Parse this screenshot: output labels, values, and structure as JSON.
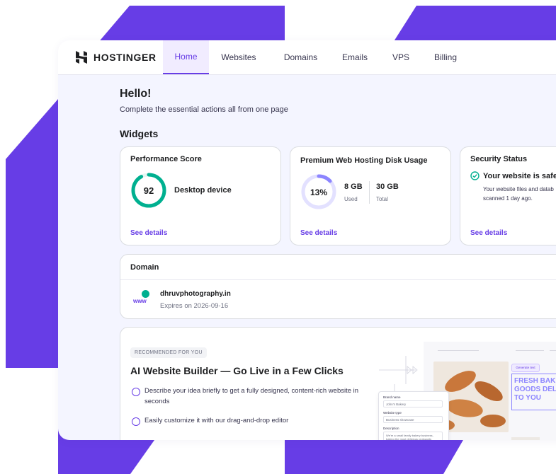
{
  "brand": {
    "name": "HOSTINGER",
    "accent": "#673de6",
    "logo_icon": "hostinger-logo"
  },
  "nav": {
    "items": [
      "Home",
      "Websites",
      "Domains",
      "Emails",
      "VPS",
      "Billing"
    ],
    "active": "Home"
  },
  "greeting": {
    "title": "Hello!",
    "subtitle": "Complete the essential actions all from one page"
  },
  "widgets": {
    "heading": "Widgets",
    "performance": {
      "title": "Performance Score",
      "score": "92",
      "score_value": 92,
      "device": "Desktop device",
      "link": "See details",
      "color": "#00b090"
    },
    "disk": {
      "title": "Premium Web Hosting Disk Usage",
      "percent": "13%",
      "percent_value": 13,
      "used_value": "8 GB",
      "used_label": "Used",
      "total_value": "30 GB",
      "total_label": "Total",
      "link": "See details",
      "color": "#8c85ff"
    },
    "security": {
      "title": "Security Status",
      "status": "Your website is safe",
      "desc_line1": "Your website files and datab",
      "desc_line2": "scanned 1 day ago.",
      "link": "See details",
      "color": "#00b090"
    }
  },
  "domain": {
    "heading": "Domain",
    "name": "dhruvphotography.in",
    "expires": "Expires on 2026-09-16",
    "icon_text": "www"
  },
  "recommended": {
    "badge": "RECOMMENDED FOR YOU",
    "title": "AI Website Builder — Go Live in a Few Clicks",
    "features": [
      {
        "line1": "Describe your idea briefly to get a fully designed, content-rich website in",
        "line2": "seconds"
      },
      {
        "line1": "Easily customize it with our drag-and-drop editor",
        "line2": ""
      }
    ],
    "preview": {
      "form_labels": [
        "Brand name",
        "Website type",
        "Description"
      ],
      "form_values": [
        "John's Bakery",
        "Business showcase",
        "We're a small family bakery business, baking the most delicious croissants"
      ],
      "generate_label": "Generate text",
      "headline_lines": [
        "FRESH BAKED",
        "GOODS DELIVE",
        "TO YOU"
      ]
    }
  }
}
